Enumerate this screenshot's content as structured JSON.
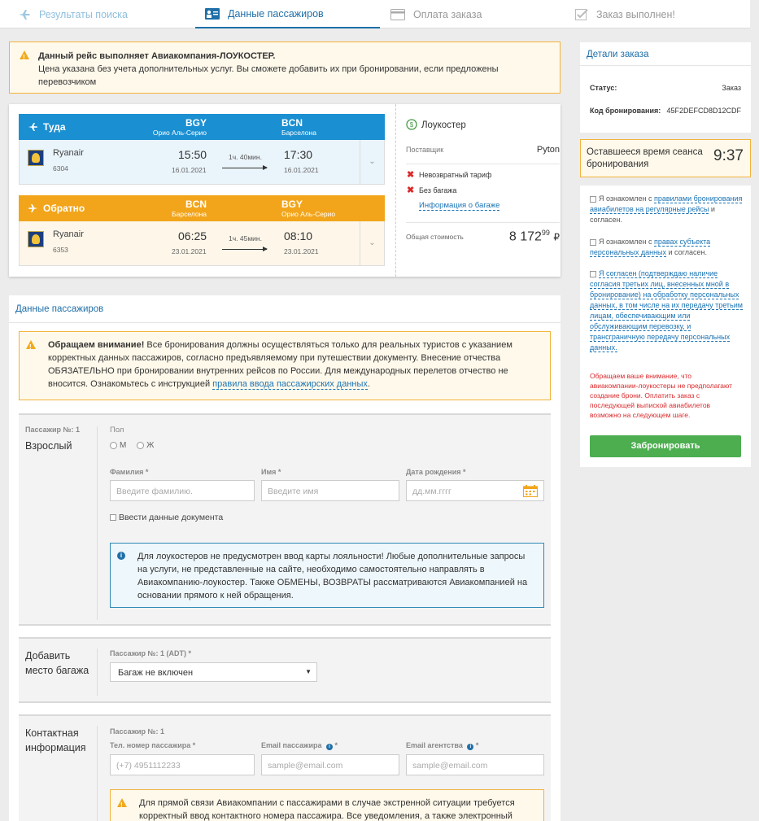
{
  "steps": [
    {
      "label": "Результаты поиска",
      "icon": "plane-icon"
    },
    {
      "label": "Данные пассажиров",
      "icon": "id-card-icon"
    },
    {
      "label": "Оплата заказа",
      "icon": "credit-card-icon"
    },
    {
      "label": "Заказ выполнен!",
      "icon": "check-square-icon"
    }
  ],
  "top_warning": {
    "title": "Данный рейс выполняет Авиакомпания-ЛОУКОСТЕР.",
    "text": "Цена указана без учета дополнительных услуг. Вы сможете добавить их при бронировании, если предложены перевозчиком"
  },
  "outbound": {
    "direction": "Туда",
    "from_code": "BGY",
    "from_city": "Орио Аль-Серио",
    "to_code": "BCN",
    "to_city": "Барселона",
    "airline": "Ryanair",
    "flight": "6304",
    "dep_time": "15:50",
    "dep_date": "16.01.2021",
    "duration": "1ч. 40мин.",
    "arr_time": "17:30",
    "arr_date": "16.01.2021"
  },
  "inbound": {
    "direction": "Обратно",
    "from_code": "BCN",
    "from_city": "Барселона",
    "to_code": "BGY",
    "to_city": "Орио Аль-Серио",
    "airline": "Ryanair",
    "flight": "6353",
    "dep_time": "06:25",
    "dep_date": "23.01.2021",
    "duration": "1ч. 45мин.",
    "arr_time": "08:10",
    "arr_date": "23.01.2021"
  },
  "fare": {
    "brand": "Лоукостер",
    "supplier_label": "Поставщик",
    "supplier": "Pyton",
    "conditions": [
      "Невозвратный тариф",
      "Без багажа"
    ],
    "baggage_link": "Информация о багаже",
    "total_label": "Общая стоимость",
    "total_main": "8 172",
    "total_cents": "99",
    "currency": "₽"
  },
  "passengers": {
    "title": "Данные пассажиров",
    "warning_bold": "Обращаем внимание!",
    "warning_text": " Все бронирования должны осуществляться только для реальных туристов с указанием корректных данных пассажиров, согласно предъявляемому при путешествии документу. Внесение отчества ОБЯЗАТЕЛЬНО при бронировании внутренних рейсов по России. Для международных перелетов отчество не вносится. Ознакомьтесь с инструкцией ",
    "warning_link": "правила ввода пассажирских данных",
    "warning_end": ".",
    "pax_no": "Пассажир №: 1",
    "pax_type": "Взрослый",
    "gender_label": "Пол",
    "gender_m": "М",
    "gender_f": "Ж",
    "surname_label": "Фамилия *",
    "surname_placeholder": "Введите фамилию.",
    "name_label": "Имя *",
    "name_placeholder": "Введите имя",
    "dob_label": "Дата рождения *",
    "dob_placeholder": "дд.мм.гггг",
    "doc_checkbox": "Ввести данные документа",
    "loyalty_info": "Для лоукостеров не предусмотрен ввод карты лояльности! Любые дополнительные запросы на услуги, не представленные на сайте, необходимо самостоятельно направлять в Авиакомпанию-лоукостер. Также ОБМЕНЫ, ВОЗВРАТЫ рассматриваются Авиакомпанией на основании прямого к ней обращения."
  },
  "baggage": {
    "title": "Добавить место багажа",
    "pax_label": "Пассажир №: 1 (ADT) *",
    "selected": "Багаж не включен"
  },
  "contacts": {
    "title": "Контактная информация",
    "pax_no": "Пассажир №: 1",
    "phone_label": "Тел. номер пассажира *",
    "phone_placeholder": "(+7) 4951112233",
    "email_label": "Email пассажира",
    "email_placeholder": "sample@email.com",
    "agency_email_label": "Email агентства",
    "agency_email_placeholder": "sample@email.com",
    "warning": "Для прямой связи Авиакомпании с пассажирами в случае экстренной ситуации требуется корректный ввод контактного номера пассажира. Все уведомления, а также электронный"
  },
  "order_details": {
    "title": "Детали заказа",
    "status_label": "Статус:",
    "status": "Заказ",
    "code_label": "Код бронирования:",
    "code": "45F2DEFCD8D12CDF"
  },
  "timer": {
    "label": "Оставшееся время сеанса бронирования",
    "value": "9:37"
  },
  "agreements": {
    "a1_pre": "Я ознакомлен с ",
    "a1_link": "правилами бронирования авиабилетов на регулярные рейсы",
    "a1_post": " и согласен.",
    "a2_pre": "Я ознакомлен с ",
    "a2_link": "правах субъекта персональных данных",
    "a2_post": " и согласен.",
    "a3_link": "Я согласен (подтверждаю наличие согласия третьих лиц, внесенных мной в бронирование) на обработку персональных данных, в том числе на их передачу третьим лицам, обеспечивающим или обслуживающим перевозку, и трансграничную передачу персональных данных.",
    "notice": "Обращаем ваше внимание, что авиакомпании-лоукостеры не предполагают создание брони. Оплатить заказ с последующей выпиской авиабилетов возможно на следующем шаге.",
    "book_button": "Забронировать"
  },
  "colors": {
    "outbound": "#1a8fd1",
    "inbound": "#f2a51b",
    "primary": "#1f6fa8",
    "book": "#4cae4f",
    "notice": "#d9292b"
  }
}
